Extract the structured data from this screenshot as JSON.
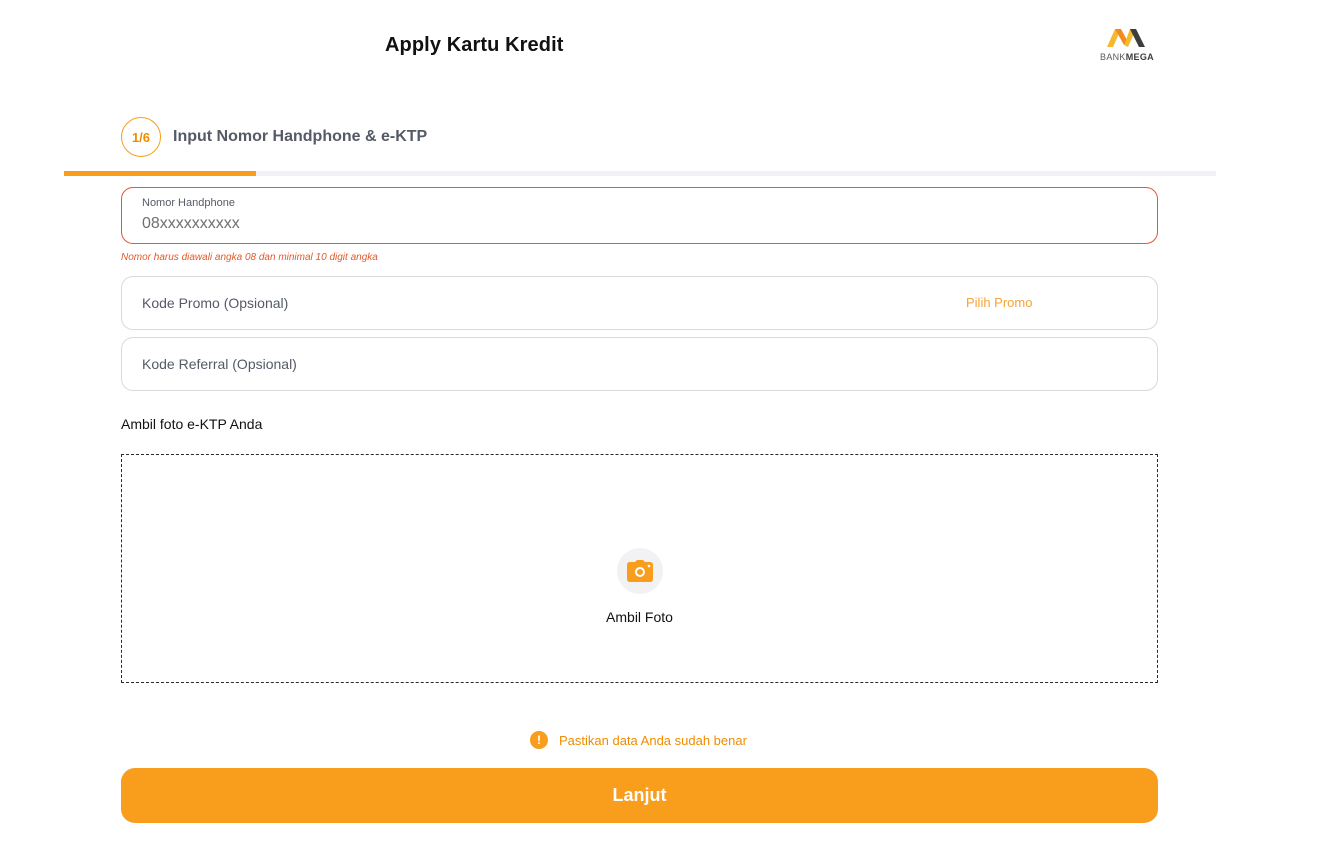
{
  "header": {
    "title": "Apply Kartu Kredit",
    "logo": {
      "bank_text": "BANK",
      "mega_text": "MEGA",
      "colors": [
        "#f5b82e",
        "#f28a1e",
        "#3d3d3d"
      ]
    }
  },
  "stepper": {
    "step_label": "1/6",
    "title": "Input Nomor Handphone & e-KTP",
    "current_step": 1,
    "total_steps": 6,
    "progress": 0.1667
  },
  "form": {
    "phone": {
      "label": "Nomor Handphone",
      "value": "",
      "placeholder": "08xxxxxxxxxx",
      "error": "Nomor harus diawali angka 08 dan minimal 10 digit angka"
    },
    "promo": {
      "placeholder": "Kode Promo (Opsional)",
      "action_label": "Pilih Promo"
    },
    "referral": {
      "placeholder": "Kode Referral (Opsional)"
    },
    "ktp": {
      "section_label": "Ambil foto e-KTP Anda",
      "button_label": "Ambil Foto",
      "icon": "camera-icon"
    }
  },
  "notice": {
    "icon": "exclamation-icon",
    "text": "Pastikan data Anda sudah benar"
  },
  "submit": {
    "label": "Lanjut"
  },
  "colors": {
    "accent": "#f99d1c",
    "accent_text": "#f08c00",
    "error": "#e05a2b",
    "muted_text": "#545a66",
    "border": "#d9d9de",
    "progress_track": "#f1f1f6"
  }
}
